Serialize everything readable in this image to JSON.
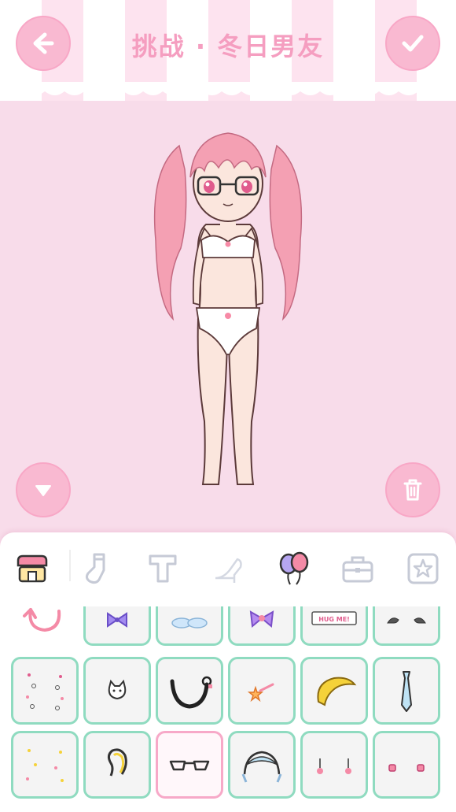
{
  "header": {
    "title": "挑战 · 冬日男友"
  },
  "icons": {
    "back": "arrow-left-icon",
    "confirm": "checkmark-icon",
    "collapse": "triangle-down-icon",
    "trash": "trash-icon"
  },
  "colors": {
    "accent": "#f9b9d1",
    "background": "#f8dcea",
    "title": "#f59ec0",
    "cell_border": "#8fdbc0",
    "selected_border": "#f7a9c8"
  },
  "tabs": [
    {
      "icon": "shop-icon",
      "active": true
    },
    {
      "icon": "sock-icon",
      "active": false
    },
    {
      "icon": "pants-icon",
      "active": false
    },
    {
      "icon": "heel-shoe-icon",
      "active": false
    },
    {
      "icon": "balloon-icon",
      "active": true
    },
    {
      "icon": "bag-icon",
      "active": false
    },
    {
      "icon": "star-icon",
      "active": false
    }
  ],
  "items": {
    "row1": [
      "purple-bow-icon",
      "sleeping-bears-icon",
      "purple-ribbon-icon",
      "hug-me-sign-icon",
      "bat-wings-icon"
    ],
    "hug_me_text": "HUG ME!",
    "row2": [
      "sparkles-icon",
      "cat-pin-icon",
      "choker-icon",
      "star-clip-icon",
      "banana-clip-icon",
      "tie-icon"
    ],
    "row3": [
      "confetti-icon",
      "twin-hair-icon",
      "glasses-icon",
      "maid-headband-icon",
      "star-earrings-icon",
      "cherry-earrings-icon"
    ],
    "selected_index": "glasses-icon"
  }
}
